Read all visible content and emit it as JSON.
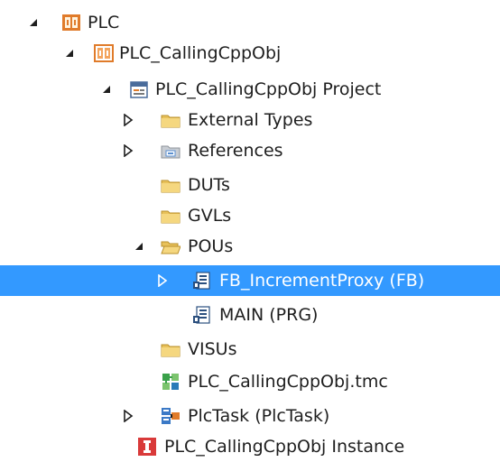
{
  "tree": {
    "items": [
      {
        "label": "PLC",
        "icon": "plc-icon",
        "expander": "expanded"
      },
      {
        "label": "PLC_CallingCppObj",
        "icon": "plc-project-icon",
        "expander": "expanded"
      },
      {
        "label": "PLC_CallingCppObj Project",
        "icon": "project-icon",
        "expander": "expanded"
      },
      {
        "label": "External Types",
        "icon": "folder-icon",
        "expander": "collapsed"
      },
      {
        "label": "References",
        "icon": "references-icon",
        "expander": "collapsed"
      },
      {
        "label": "DUTs",
        "icon": "folder-icon",
        "expander": "none"
      },
      {
        "label": "GVLs",
        "icon": "folder-icon",
        "expander": "none"
      },
      {
        "label": "POUs",
        "icon": "folder-open-icon",
        "expander": "expanded"
      },
      {
        "label": "FB_IncrementProxy (FB)",
        "icon": "pou-icon",
        "expander": "collapsed",
        "selected": true
      },
      {
        "label": "MAIN (PRG)",
        "icon": "pou-icon",
        "expander": "none"
      },
      {
        "label": "VISUs",
        "icon": "folder-icon",
        "expander": "none"
      },
      {
        "label": "PLC_CallingCppObj.tmc",
        "icon": "tmc-file-icon",
        "expander": "none"
      },
      {
        "label": "PlcTask (PlcTask)",
        "icon": "task-icon",
        "expander": "collapsed"
      },
      {
        "label": "PLC_CallingCppObj Instance",
        "icon": "instance-icon",
        "expander": "none"
      }
    ]
  },
  "colors": {
    "selection": "#3399ff",
    "folder": "#e8c15a",
    "plc_orange": "#e07b2a",
    "instance_red": "#d93a3a"
  }
}
